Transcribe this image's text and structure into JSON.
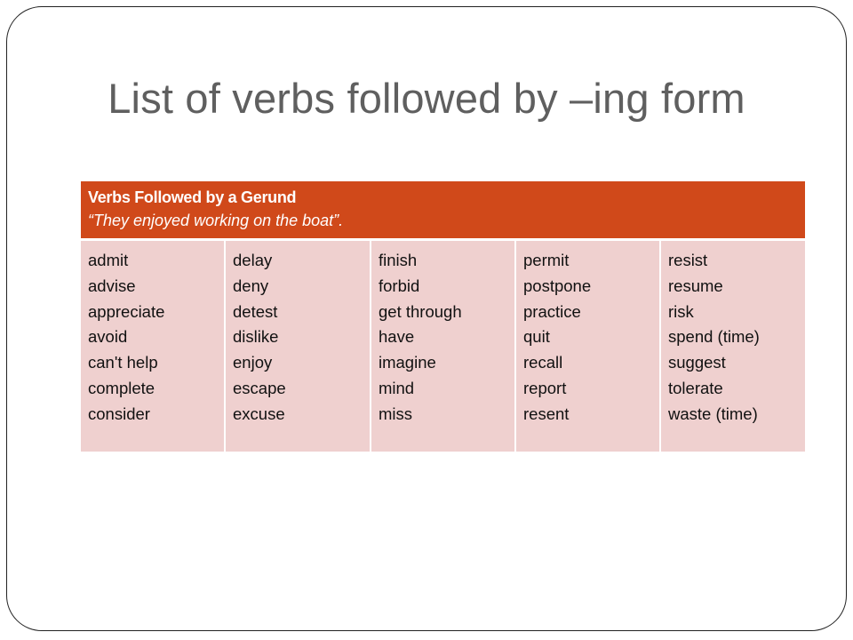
{
  "slide": {
    "title": "List of verbs followed by –ing form",
    "table": {
      "header_title": "Verbs Followed by a Gerund",
      "header_example": "“They enjoyed working on the boat”.",
      "columns": [
        [
          "admit",
          "advise",
          "appreciate",
          "avoid",
          "can't help",
          "complete",
          "consider"
        ],
        [
          "delay",
          "deny",
          "detest",
          "dislike",
          "enjoy",
          "escape",
          "excuse"
        ],
        [
          "finish",
          "forbid",
          "get through",
          "have",
          "imagine",
          "mind",
          "miss"
        ],
        [
          "permit",
          "postpone",
          "practice",
          "quit",
          "recall",
          "report",
          "resent"
        ],
        [
          "resist",
          "resume",
          "risk",
          "spend (time)",
          "suggest",
          "tolerate",
          "waste (time)"
        ]
      ]
    },
    "colors": {
      "header_bg": "#d0491a",
      "cell_bg": "#efd0cf",
      "title_text": "#5f5f5f"
    }
  }
}
